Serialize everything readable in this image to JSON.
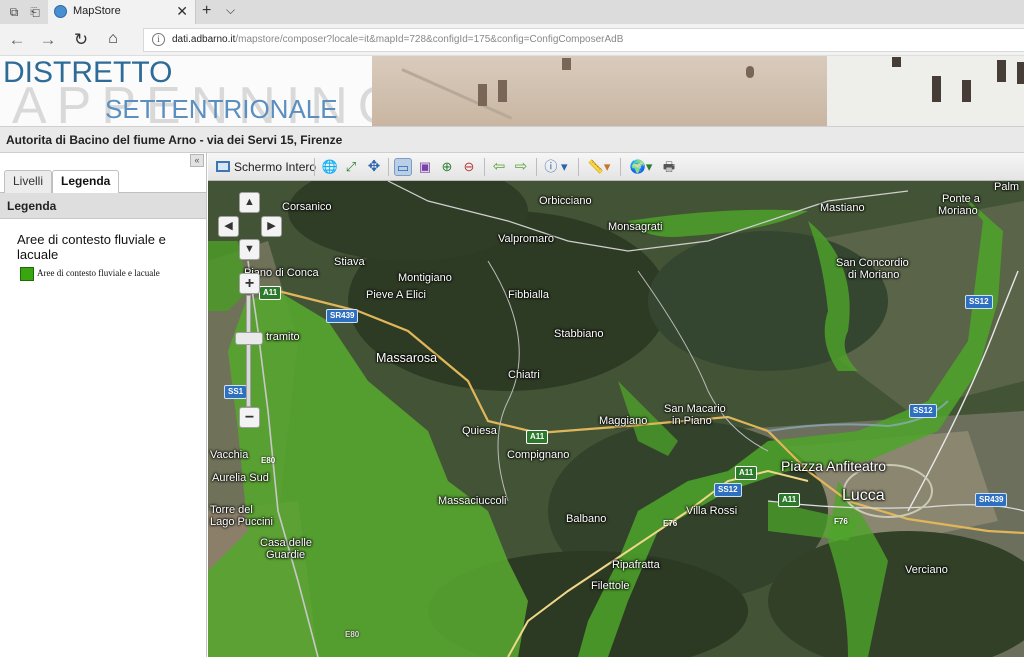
{
  "browser": {
    "tab_title": "MapStore",
    "url_domain": "dati.adbarno.it",
    "url_path": "/mapstore/composer?locale=it&mapId=728&configId=175&config=ConfigComposerAdB"
  },
  "banner": {
    "logo_line1": "DISTRETTO",
    "logo_line2": "SETTENTRIONALE",
    "logo_background_word": "APPENNINO"
  },
  "title": "Autorita di Bacino del fiume Arno - via dei Servi 15, Firenze",
  "panel": {
    "tabs": [
      "Livelli",
      "Legenda"
    ],
    "active_tab": "Legenda",
    "header": "Legenda",
    "legend_group": "Aree di contesto fluviale e lacuale",
    "legend_item": "Aree di contesto fluviale e lacuale",
    "legend_color": "#3aa60f"
  },
  "toolbar": {
    "fullscreen_label": "Schermo Intero"
  },
  "map": {
    "places": [
      "Orbicciano",
      "Mastiano",
      "Ponte a",
      "Moriano",
      "Corsanico",
      "Monsagrati",
      "Valpromaro",
      "Stiava",
      "San Concordio",
      "di Moriano",
      "Piano di Conca",
      "Montigiano",
      "Pieve A Elici",
      "Fibbialla",
      "Stabbiano",
      "Massarosa",
      "Chiatri",
      "Maggiano",
      "San Macario",
      "in Piano",
      "Quiesa",
      "Compignano",
      "Piazza Anfiteatro",
      "Lucca",
      "Aurelia Sud",
      "Massaciuccoli",
      "Balbano",
      "Villa Rossi",
      "Torre del",
      "Lago Puccini",
      "Casa delle",
      "Guardie",
      "Ripafratta",
      "Filettole",
      "Verciano",
      "Palm",
      "tramito",
      "Vacchia"
    ],
    "road_shields": [
      "SR439",
      "SS1",
      "E80",
      "A11",
      "A11",
      "A11",
      "SS12",
      "SS12",
      "SS12",
      "F76",
      "E76",
      "A11",
      "SR439",
      "E80"
    ]
  }
}
